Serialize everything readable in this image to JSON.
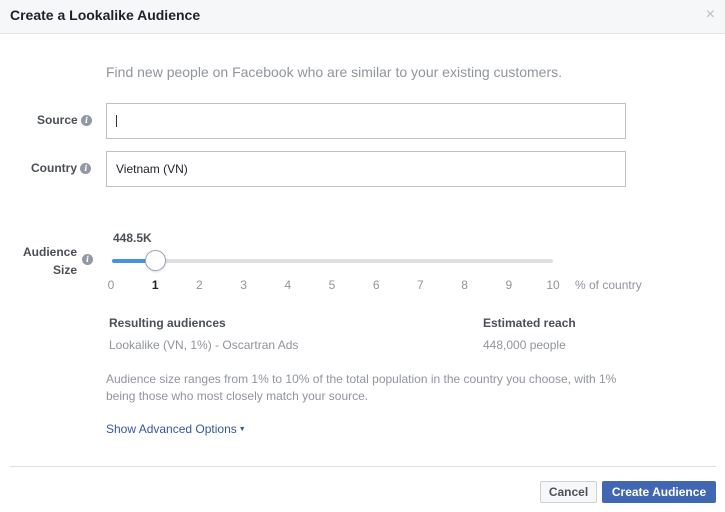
{
  "dialog": {
    "title": "Create a Lookalike Audience",
    "close_symbol": "×",
    "intro": "Find new people on Facebook who are similar to your existing customers."
  },
  "source": {
    "label": "Source",
    "value": "",
    "info_icon": "info-icon"
  },
  "country": {
    "label": "Country",
    "value": "Vietnam (VN)",
    "info_icon": "info-icon"
  },
  "audience_size": {
    "label_line1": "Audience",
    "label_line2": "Size",
    "slider_value_label": "448.5K",
    "selected": 1,
    "min": 0,
    "max": 10,
    "ticks": [
      "0",
      "1",
      "2",
      "3",
      "4",
      "5",
      "6",
      "7",
      "8",
      "9",
      "10"
    ],
    "unit_label": "% of country",
    "accent_color": "#4a90e2"
  },
  "results": {
    "resulting_header": "Resulting audiences",
    "resulting_value": "Lookalike (VN, 1%) - Oscartran Ads",
    "reach_header": "Estimated reach",
    "reach_value": "448,000 people"
  },
  "note": "Audience size ranges from 1% to 10% of the total population in the country you choose, with 1% being those who most closely match your source.",
  "advanced_link": "Show Advanced Options",
  "buttons": {
    "cancel": "Cancel",
    "create": "Create Audience",
    "create_color": "#4267b2"
  }
}
